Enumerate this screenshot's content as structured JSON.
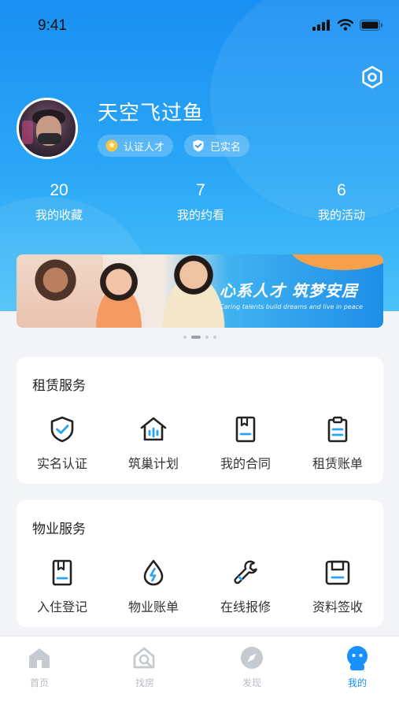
{
  "status_bar": {
    "time": "9:41"
  },
  "profile": {
    "name": "天空飞过鱼",
    "badges": [
      {
        "label": "认证人才",
        "icon": "gear-icon"
      },
      {
        "label": "已实名",
        "icon": "shield-check-icon"
      }
    ]
  },
  "stats": [
    {
      "value": "20",
      "label": "我的收藏"
    },
    {
      "value": "7",
      "label": "我的约看"
    },
    {
      "value": "6",
      "label": "我的活动"
    }
  ],
  "banner": {
    "title": "心系人才 筑梦安居",
    "subtitle": "Caring talents build dreams and live in peace"
  },
  "sections": [
    {
      "title": "租赁服务",
      "items": [
        {
          "label": "实名认证",
          "icon": "shield-check-icon"
        },
        {
          "label": "筑巢计划",
          "icon": "house-icon"
        },
        {
          "label": "我的合同",
          "icon": "contract-icon"
        },
        {
          "label": "租赁账单",
          "icon": "clipboard-icon"
        }
      ]
    },
    {
      "title": "物业服务",
      "items": [
        {
          "label": "入住登记",
          "icon": "bookmark-icon"
        },
        {
          "label": "物业账单",
          "icon": "utility-drop-icon"
        },
        {
          "label": "在线报修",
          "icon": "wrench-icon"
        },
        {
          "label": "资料签收",
          "icon": "save-icon"
        }
      ]
    }
  ],
  "tabbar": [
    {
      "label": "首页",
      "icon": "home-icon",
      "active": false
    },
    {
      "label": "找房",
      "icon": "search-house-icon",
      "active": false
    },
    {
      "label": "发现",
      "icon": "compass-icon",
      "active": false
    },
    {
      "label": "我的",
      "icon": "profile-icon",
      "active": true
    }
  ],
  "colors": {
    "primary": "#1890ff",
    "hero_top": "#1a8ff3",
    "hero_bottom": "#4cc2f8",
    "icon_accent": "#29a3f3"
  }
}
